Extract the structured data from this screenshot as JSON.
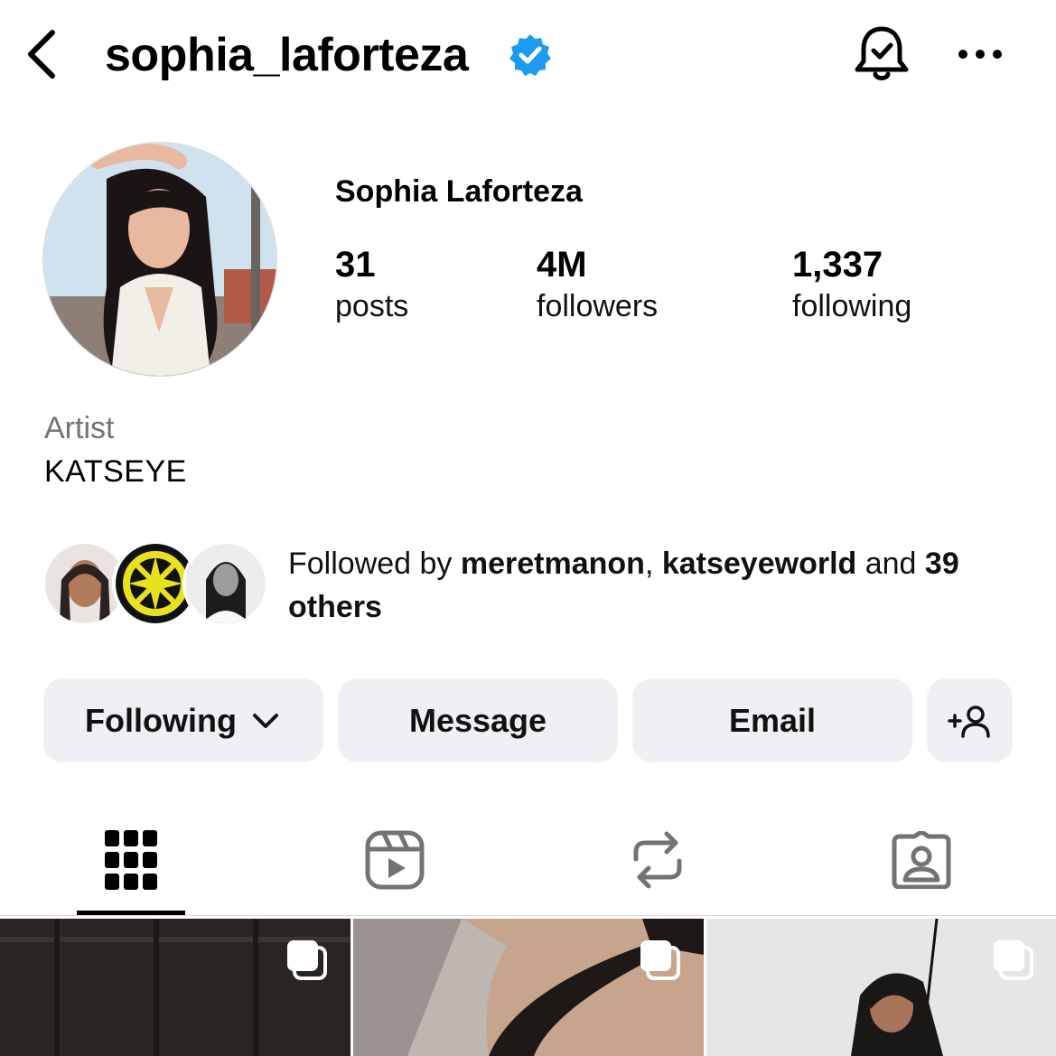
{
  "header": {
    "username": "sophia_laforteza",
    "verified": true,
    "icons": [
      "back-arrow-icon",
      "verified-badge-icon",
      "notification-bell-icon",
      "more-options-icon"
    ]
  },
  "profile": {
    "full_name": "Sophia Laforteza",
    "stats": [
      {
        "value": "31",
        "label": "posts"
      },
      {
        "value": "4M",
        "label": "followers"
      },
      {
        "value": "1,337",
        "label": "following"
      }
    ],
    "category": "Artist",
    "bio": "KATSEYE"
  },
  "followed_by": {
    "prefix": "Followed by ",
    "names": [
      "meretmanon",
      "katseyeworld"
    ],
    "separator": ", ",
    "conjunction": " and ",
    "others": "39 others"
  },
  "actions": {
    "following": "Following",
    "message": "Message",
    "email": "Email"
  },
  "tabs": [
    "grid-tab-icon",
    "reels-tab-icon",
    "reposts-tab-icon",
    "tagged-tab-icon"
  ],
  "colors": {
    "verified": "#1d9bf0",
    "button_bg": "#eff0f4",
    "secondary_text": "#737373"
  }
}
